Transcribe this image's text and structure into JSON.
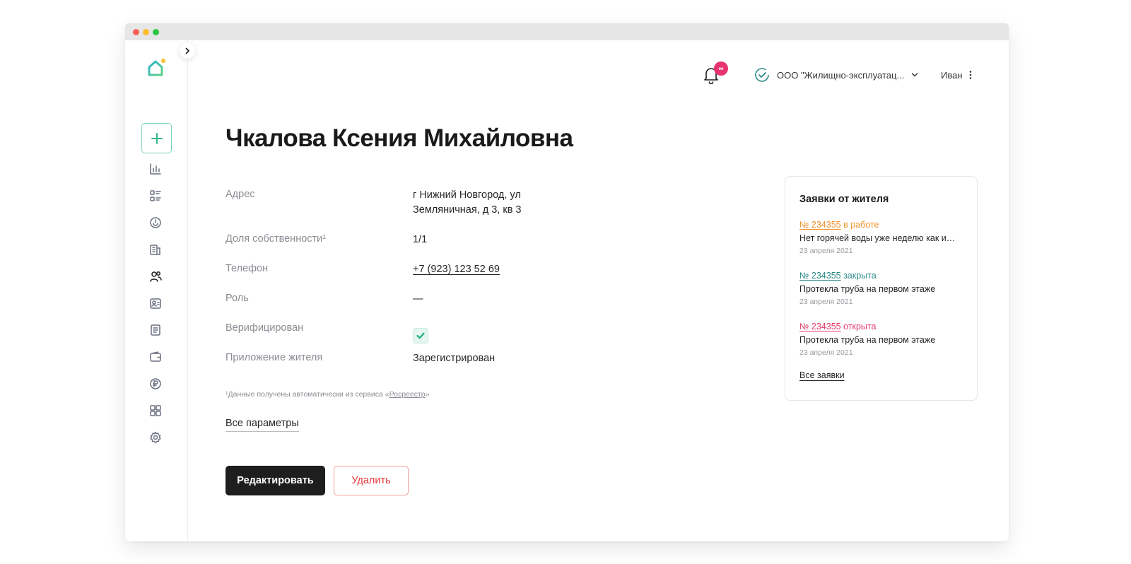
{
  "header": {
    "notification_badge": "∞",
    "organization": "ООО \"Жилищно-эксплуатац...",
    "user_name": "Иван"
  },
  "sidebar": {
    "items": [
      {
        "icon": "chart-icon"
      },
      {
        "icon": "list-icon"
      },
      {
        "icon": "gauge-icon"
      },
      {
        "icon": "building-icon"
      },
      {
        "icon": "users-icon",
        "active": true
      },
      {
        "icon": "id-card-icon"
      },
      {
        "icon": "document-icon"
      },
      {
        "icon": "wallet-icon"
      },
      {
        "icon": "ruble-icon"
      },
      {
        "icon": "grid-icon"
      },
      {
        "icon": "gear-icon"
      }
    ]
  },
  "page": {
    "title": "Чкалова Ксения Михайловна",
    "fields": {
      "address_label": "Адрес",
      "address_line1": "г Нижний Новгород, ул",
      "address_line2": "Земляничная, д 3, кв 3",
      "share_label": "Доля собственности¹",
      "share_value": "1/1",
      "phone_label": "Телефон",
      "phone_value": "+7 (923) 123 52 69",
      "role_label": "Роль",
      "role_value": "—",
      "verified_label": "Верифицирован",
      "app_label": "Приложение жителя",
      "app_value": "Зарегистрирован"
    },
    "footnote_prefix": "¹Данные получены автоматически из сервиса «",
    "footnote_link": "Росреестр",
    "footnote_suffix": "»",
    "all_params": "Все параметры",
    "edit_button": "Редактировать",
    "delete_button": "Удалить"
  },
  "requests_card": {
    "title": "Заявки от жителя",
    "items": [
      {
        "number": "№ 234355",
        "status": "в работе",
        "text": "Нет горячей воды уже неделю как и…",
        "date": "23 апреля 2021"
      },
      {
        "number": "№ 234355",
        "status": "закрыта",
        "text": "Протекла труба на первом этаже",
        "date": "23 апреля 2021"
      },
      {
        "number": "№ 234355",
        "status": "открыта",
        "text": "Протекла труба на первом этаже",
        "date": "23 апреля 2021"
      }
    ],
    "all_link": "Все заявки"
  },
  "colors": {
    "accent_green": "#2cb88a",
    "status_in_work": "#f0922b",
    "status_closed": "#2a8a86",
    "status_open": "#e6396b"
  }
}
